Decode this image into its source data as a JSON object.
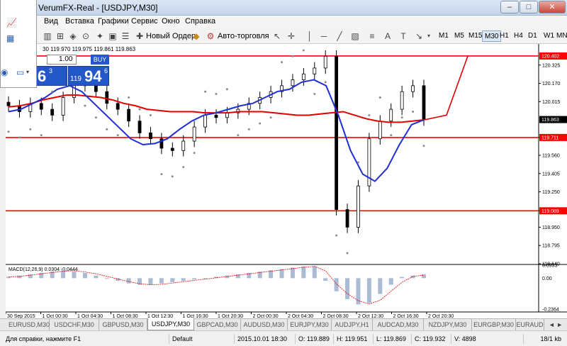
{
  "window": {
    "title": "VerumFX-Real - [USDJPY,M30]",
    "min_glyph": "–",
    "max_glyph": "□",
    "close_glyph": "✕",
    "app_icon": "mt4-icon"
  },
  "menu": [
    "Вид",
    "Вставка",
    "Графики",
    "Сервис",
    "Окно",
    "Справка"
  ],
  "toolbar": {
    "new_order": "Новый Ордер",
    "auto_trading": "Авто-торговля",
    "timeframes": [
      "M1",
      "M5",
      "M15",
      "M30",
      "H1",
      "H4",
      "D1",
      "W1",
      "MN"
    ],
    "active_timeframe": "M30"
  },
  "chart": {
    "info": "30  119.970 119.975 119.861 119.863",
    "lot": "1.00",
    "buy_label": "BUY",
    "sell_price": {
      "small": "",
      "big": "6",
      "sup": "3"
    },
    "buy_price": {
      "small": "119",
      "big": "94",
      "sup": "6"
    },
    "macd_label": "MACD(12,26,9) 0.0304 -0.0444",
    "colors": {
      "candles": "#000000",
      "ma_red": "#e00000",
      "ma_blue": "#1f2fd0",
      "sar": "#8a8a8a",
      "level": "#ff0000",
      "macd_hist": "#aabbd4",
      "signal": "#e00000"
    }
  },
  "chart_data": {
    "type": "line",
    "title": "",
    "xlabel": "",
    "ylabel": "",
    "ylim": [
      118.64,
      120.48
    ],
    "y_ticks": [
      "120.325",
      "120.170",
      "120.015",
      "119.711",
      "119.560",
      "119.405",
      "119.250",
      "119.089",
      "118.950",
      "118.795",
      "118.640"
    ],
    "x_ticks": [
      "30 Sep 2015",
      "1 Oct 00:30",
      "1 Oct 04:30",
      "1 Oct 08:30",
      "1 Oct 12:30",
      "1 Oct 16:30",
      "1 Oct 20:30",
      "2 Oct 00:30",
      "2 Oct 04:30",
      "2 Oct 08:30",
      "2 Oct 12:30",
      "2 Oct 16:30",
      "2 Oct 20:30"
    ],
    "levels": [
      {
        "value": 120.402,
        "label": "120.402"
      },
      {
        "value": 119.711,
        "label": "119.711"
      },
      {
        "value": 119.089,
        "label": "119.089"
      }
    ],
    "current_price": {
      "value": 119.863,
      "label": "119.863"
    },
    "macd_axis": {
      "ylim": [
        -0.2364,
        0.0993
      ],
      "ticks": [
        "0.0993",
        "0.00",
        "-0.2364"
      ]
    },
    "series": [
      {
        "values": [
          119.98,
          119.93,
          120.0,
          119.95,
          119.9,
          120.05,
          120.15,
          120.2,
          120.1,
          120.0,
          119.95,
          119.85,
          119.75,
          119.7,
          119.62,
          119.6,
          119.68,
          119.8,
          119.9,
          119.88,
          119.92,
          119.95,
          120.0,
          120.05,
          120.1,
          120.15,
          120.2,
          120.25,
          120.3,
          120.4,
          119.1,
          118.95,
          119.3,
          119.7,
          119.85,
          119.95,
          120.1,
          120.15,
          119.86
        ]
      },
      {
        "values": [
          119.97,
          119.98,
          120.0,
          120.03,
          120.05,
          120.07,
          120.07,
          120.06,
          120.05,
          120.03,
          120.0,
          119.98,
          119.95,
          119.94,
          119.93,
          119.93,
          119.93,
          119.92,
          119.92,
          119.92,
          119.93,
          119.93,
          119.93,
          119.92,
          119.91,
          119.9,
          119.9,
          119.91,
          119.92,
          119.93,
          119.9,
          119.87,
          119.85,
          119.84,
          119.84,
          119.85,
          119.86
        ]
      },
      {
        "values": [
          119.93,
          119.95,
          120.0,
          120.05,
          120.12,
          120.15,
          120.1,
          120.0,
          119.9,
          119.8,
          119.7,
          119.65,
          119.66,
          119.7,
          119.78,
          119.85,
          119.9,
          119.92,
          119.95,
          119.98,
          120.0,
          120.05,
          120.1,
          120.12,
          120.18,
          120.2,
          120.15,
          119.9,
          119.6,
          119.4,
          119.34,
          119.45,
          119.65,
          119.82,
          119.86
        ]
      },
      {
        "values": [
          0.01,
          0.02,
          0.03,
          0.04,
          0.05,
          0.06,
          0.05,
          0.04,
          0.02,
          0.0,
          -0.02,
          -0.04,
          -0.05,
          -0.05,
          -0.04,
          -0.03,
          -0.02,
          -0.01,
          0.0,
          0.01,
          0.02,
          0.03,
          0.04,
          0.05,
          0.06,
          0.07,
          0.08,
          0.09,
          0.09,
          -0.02,
          -0.1,
          -0.16,
          -0.2,
          -0.19,
          -0.12,
          -0.05,
          0.01,
          0.02,
          0.03
        ]
      }
    ]
  },
  "symbol_tabs": [
    "EURUSD,M30",
    "USDCHF,M30",
    "GBPUSD,M30",
    "USDJPY,M30",
    "GBPCAD,M30",
    "AUDUSD,M30",
    "EURJPY,M30",
    "AUDJPY,H1",
    "AUDCAD,M30",
    "NZDJPY,M30",
    "EURGBP,M30",
    "EURAUD"
  ],
  "active_tab": "USDJPY,M30",
  "tab_scroll": "◄ ►",
  "status": {
    "help": "Для справки, нажмите F1",
    "profile": "Default",
    "datetime": "2015.10.01 18:30",
    "open": "O: 119.889",
    "high": "H: 119.951",
    "low": "L: 119.869",
    "close": "C: 119.932",
    "volume": "V: 4898",
    "traffic": "18/1 kb"
  }
}
